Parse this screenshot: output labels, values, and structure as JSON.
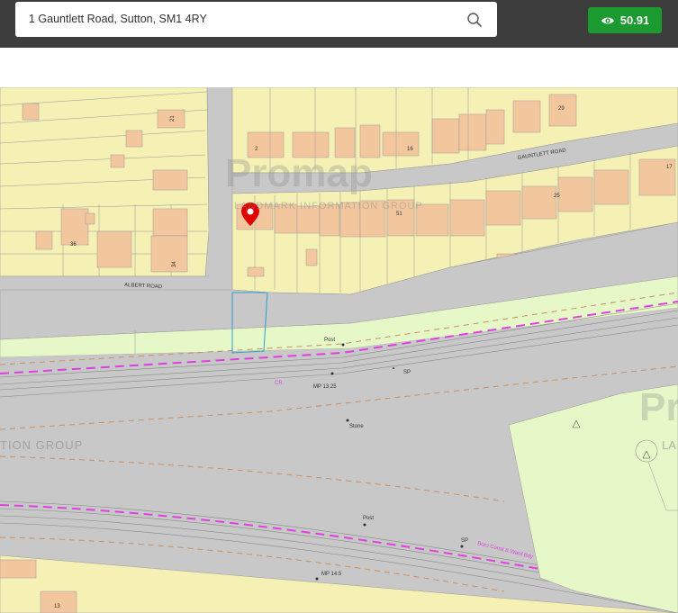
{
  "search": {
    "value": "1 Gauntlett Road, Sutton, SM1 4RY",
    "icon": "search-icon"
  },
  "credits": {
    "value": "50.91",
    "icon": "eye-icon",
    "color": "#1a9a2f"
  },
  "map": {
    "watermark": {
      "brand": "Promap",
      "tagline": "LANDMARK INFORMATION GROUP",
      "tagline_left": "TION GROUP",
      "brand_right": "Pr",
      "tagline_right": "LA"
    },
    "roads": {
      "gauntlett": "GAUNTLETT ROAD",
      "albert": "ALBERT ROAD"
    },
    "labels": {
      "post1": "Post",
      "sp1": "SP",
      "cr": "CR",
      "mp1": "MP 13.25",
      "stone": "Stone",
      "post2": "Post",
      "sp2": "SP",
      "mp2": "MP 14.5",
      "boundary": "Boro Const & Ward Bdy"
    },
    "house_numbers": {
      "n21": "21",
      "n2": "2",
      "n16": "16",
      "n29": "29",
      "n51": "51",
      "n36": "36",
      "n34": "34",
      "n17": "17",
      "n25": "25",
      "n13": "13"
    },
    "colors": {
      "building": "#f5f0b4",
      "house": "#f2c79e",
      "road": "#c8c8c8",
      "green": "#e6f8c8",
      "rail_line": "#e040e0",
      "marker": "#e00000",
      "plot": "#2aa0d0"
    }
  }
}
